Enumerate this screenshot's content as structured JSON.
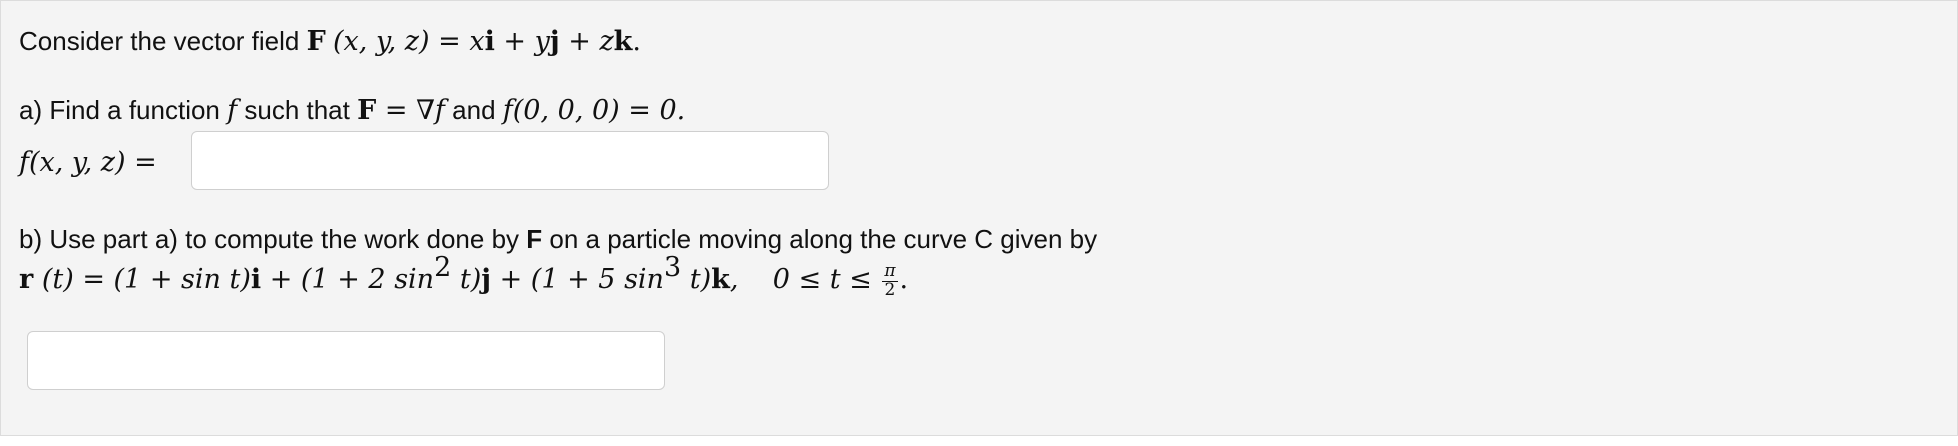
{
  "prompt": {
    "intro_text": "Consider the vector field",
    "field_F": "F",
    "field_args": "(x, y, z)",
    "field_eq": " = x",
    "unit_i": "i",
    "plus_y": " + y",
    "unit_j": "j",
    "plus_z": " + z",
    "unit_k": "k",
    "period": "."
  },
  "part_a": {
    "text1": "a) Find a function",
    "f": "f",
    "text2": "such that",
    "F": "F",
    "eq_grad": " = ∇",
    "f2": "f",
    "text3": "and",
    "cond": "f(0, 0, 0) = 0.",
    "answer_label": "f(x, y, z) =",
    "answer_value": "",
    "answer_placeholder": ""
  },
  "part_b": {
    "text_before": "b) Use part a) to compute the work done by",
    "F": "F",
    "text_after": "on a particle moving along the curve C given by",
    "r": "r",
    "expr_1": " (t) = (1 + sin t)",
    "i": "i",
    "expr_2": " + (1 + 2 sin",
    "exp2": "2",
    "expr_3": " t)",
    "j": "j",
    "expr_4": " + (1 + 5 sin",
    "exp3": "3",
    "expr_5": " t)",
    "k": "k",
    "expr_6": ",    0 ≤ t ≤ ",
    "frac_num": "π",
    "frac_den": "2",
    "end": ".",
    "answer_value": "",
    "answer_placeholder": ""
  }
}
